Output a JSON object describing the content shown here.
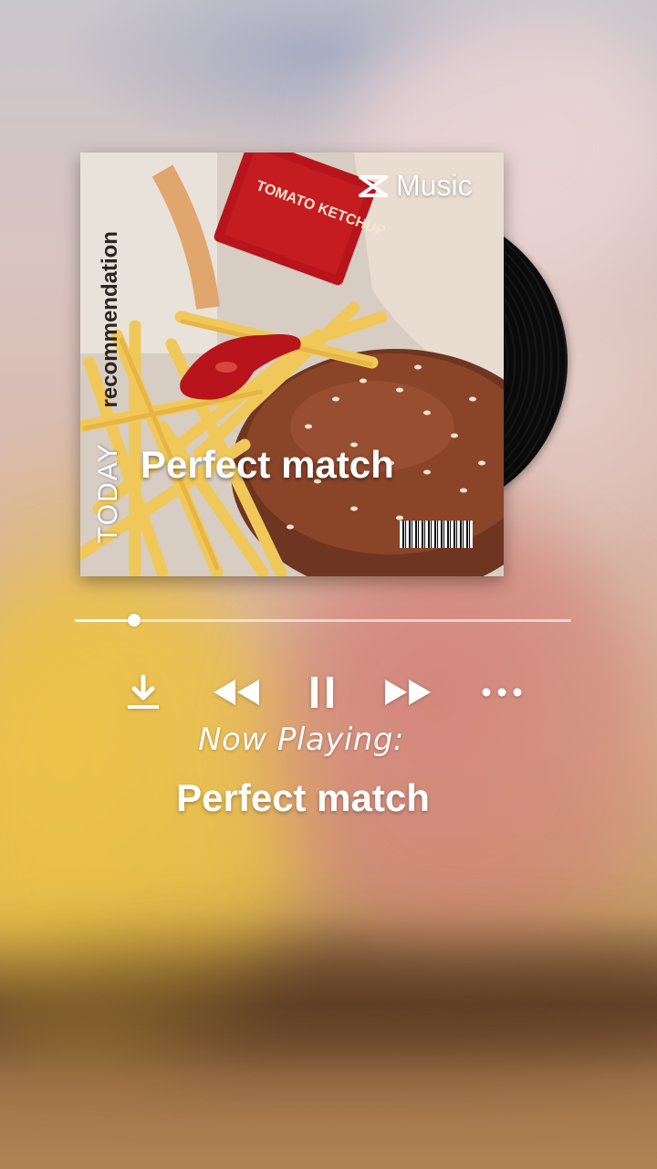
{
  "album": {
    "brand": "Music",
    "vertical_left": "TODAY",
    "vertical_right": "recommendation",
    "cover_title": "Perfect match",
    "packet_text": "TOMATO KETCHUP"
  },
  "player": {
    "progress": 0.12,
    "now_playing_label": "Now Playing:",
    "track_title": "Perfect match",
    "is_playing": true
  },
  "controls": {
    "download_icon": "download-icon",
    "rewind_icon": "rewind-icon",
    "pause_icon": "pause-icon",
    "forward_icon": "fast-forward-icon",
    "more_icon": "more-horizontal-icon"
  },
  "colors": {
    "ketchup": "#b8141c",
    "bun": "#7a3b22",
    "fries": "#f0c85a",
    "text": "#ffffff"
  }
}
